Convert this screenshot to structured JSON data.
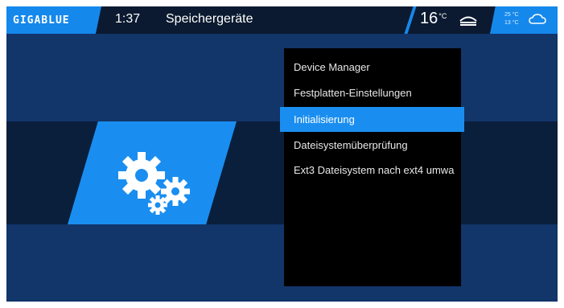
{
  "header": {
    "logo": "GIGABLUE",
    "time": "1:37",
    "title": "Speichergeräte",
    "temperature": "16",
    "temperature_unit": "°C",
    "tuner_icon": "tuner-icon",
    "weather": {
      "high": "25 °C",
      "low": "13 °C",
      "icon": "cloud-icon"
    }
  },
  "menu": {
    "items": [
      {
        "label": "Device Manager",
        "selected": false
      },
      {
        "label": "Festplatten-Einstellungen",
        "selected": false
      },
      {
        "label": "Initialisierung",
        "selected": true
      },
      {
        "label": "Dateisystemüberprüfung",
        "selected": false
      },
      {
        "label": "Ext3 Dateisystem nach ext4 umwa",
        "selected": false
      }
    ]
  },
  "colors": {
    "accent": "#1a8ef0",
    "background": "#0f2a50",
    "menu_bg": "#000000"
  },
  "icons": {
    "settings": "gears-icon"
  }
}
